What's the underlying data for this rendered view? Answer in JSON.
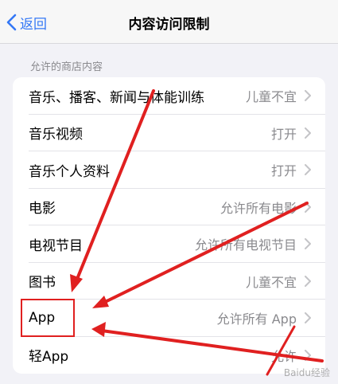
{
  "navbar": {
    "back_label": "返回",
    "title": "内容访问限制"
  },
  "section": {
    "header": "允许的商店内容"
  },
  "rows": [
    {
      "label": "音乐、播客、新闻与体能训练",
      "value": "儿童不宜"
    },
    {
      "label": "音乐视频",
      "value": "打开"
    },
    {
      "label": "音乐个人资料",
      "value": "打开"
    },
    {
      "label": "电影",
      "value": "允许所有电影"
    },
    {
      "label": "电视节目",
      "value": "允许所有电视节目"
    },
    {
      "label": "图书",
      "value": "儿童不宜"
    },
    {
      "label": "App",
      "value": "允许所有 App"
    },
    {
      "label": "轻App",
      "value": "允许"
    }
  ],
  "watermark": "Baidu经验",
  "colors": {
    "accent": "#3478f6",
    "annotation": "#e02020",
    "background": "#f2f2f7"
  }
}
